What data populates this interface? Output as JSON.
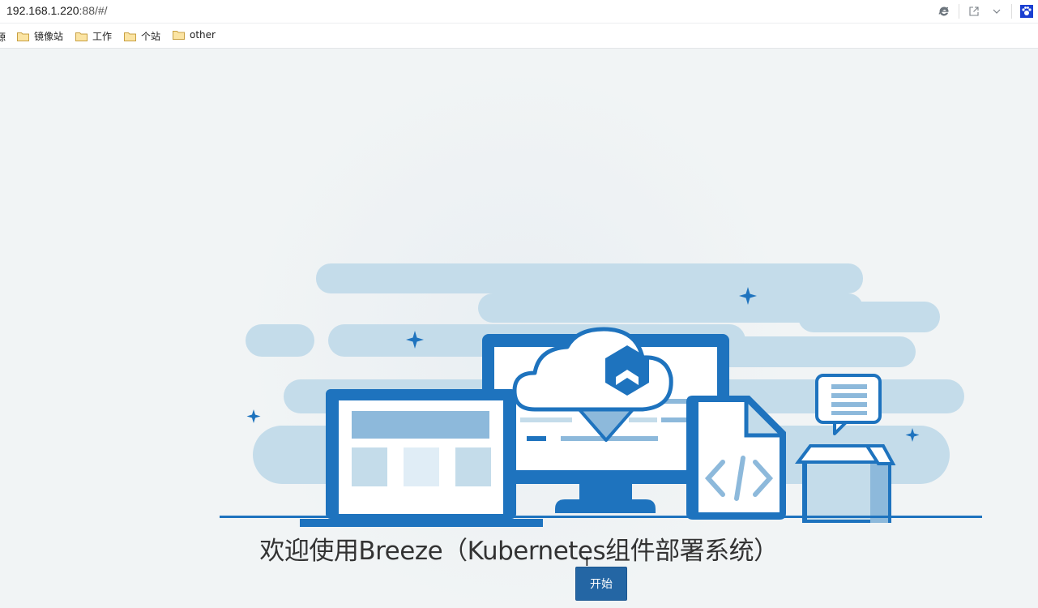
{
  "address_bar": {
    "url_host": "192.168.1.220",
    "url_rest": ":88/#/",
    "icons": [
      "ie-mode-icon",
      "share-icon",
      "chevron-down-icon",
      "paw-extension-icon"
    ]
  },
  "bookmarks": {
    "cut_item_label": "源",
    "items": [
      {
        "label": "镜像站",
        "icon": "folder-icon"
      },
      {
        "label": "工作",
        "icon": "folder-icon"
      },
      {
        "label": "个站",
        "icon": "folder-icon"
      },
      {
        "label": "other",
        "icon": "folder-icon"
      }
    ]
  },
  "main": {
    "welcome_text": "欢迎使用Breeze（Kubernetes组件部署系统）",
    "start_button_label": "开始"
  },
  "colors": {
    "primary": "#2466a4",
    "illustration_blue": "#1e73be",
    "light_blue": "#c4dcea"
  }
}
